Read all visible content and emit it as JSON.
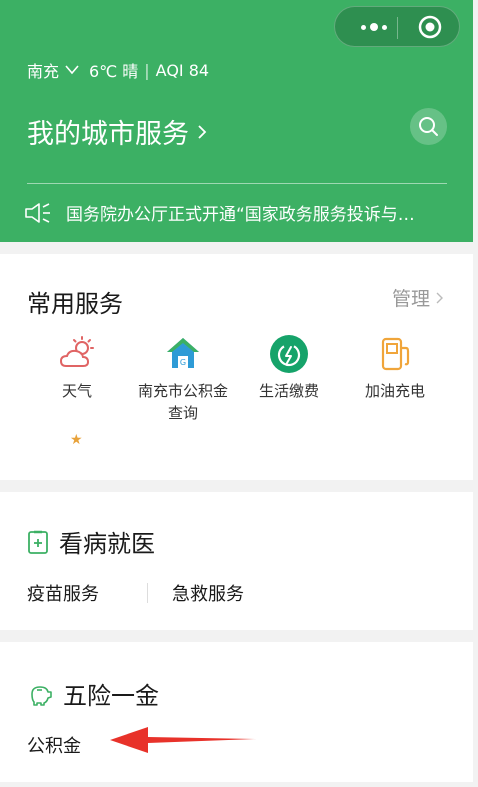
{
  "header": {
    "city": "南充",
    "weather": "6℃ 晴",
    "aqi": "AQI 84",
    "title": "我的城市服务",
    "notice": "国务院办公厅正式开通“国家政务服务投诉与…",
    "colors": {
      "brand": "#3cb064"
    }
  },
  "common": {
    "title": "常用服务",
    "manage_label": "管理",
    "items": [
      {
        "label": "天气",
        "icon": "weather-icon"
      },
      {
        "label": "南充市公积金查询",
        "icon": "housing-fund-icon"
      },
      {
        "label": "生活缴费",
        "icon": "utility-payment-icon"
      },
      {
        "label": "加油充电",
        "icon": "fuel-charging-icon"
      }
    ],
    "star": "★"
  },
  "medical": {
    "title": "看病就医",
    "links": [
      "疫苗服务",
      "急救服务"
    ]
  },
  "insurance": {
    "title": "五险一金",
    "links": [
      "公积金"
    ]
  }
}
